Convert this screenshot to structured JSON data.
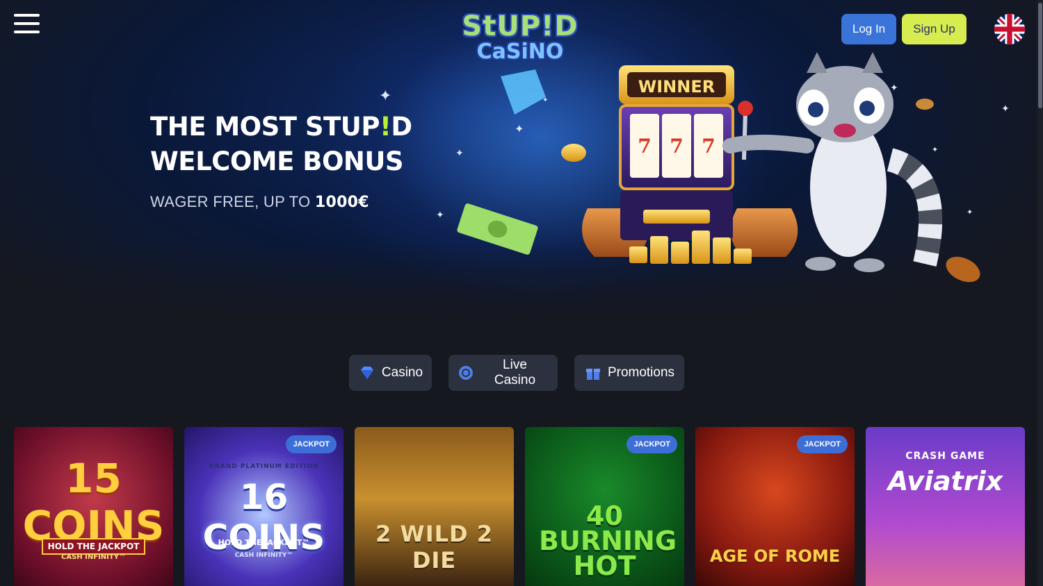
{
  "header": {
    "logo_line1": "StUP!D",
    "logo_line2": "CaSiNO",
    "login_label": "Log In",
    "signup_label": "Sign Up",
    "language_icon": "uk-flag-icon"
  },
  "hero": {
    "title_part1": "THE MOST STUP",
    "title_bang": "!",
    "title_part2": "D",
    "title_line2": "WELCOME BONUS",
    "subtitle_prefix": "WAGER FREE, UP TO ",
    "subtitle_amount": "1000€",
    "slot_banner": "WINNER"
  },
  "categories": [
    {
      "label": "Casino",
      "icon": "diamond-icon"
    },
    {
      "label": "Live Casino",
      "icon": "poker-chip-icon"
    },
    {
      "label": "Promotions",
      "icon": "gift-icon"
    }
  ],
  "games": [
    {
      "title": "15 COINS",
      "tagline": "HOLD THE JACKPOT",
      "sub": "CASH INFINITY™",
      "badge": ""
    },
    {
      "title": "16 COINS",
      "tagline": "HOLD THE JACKPOT™",
      "sub": "CASH INFINITY™",
      "top": "GRAND PLATINUM EDITION",
      "badge": "JACKPOT"
    },
    {
      "title": "2 WILD 2 DIE",
      "badge": ""
    },
    {
      "title": "40 BURNING HOT",
      "badge": "JACKPOT"
    },
    {
      "title": "AGE OF ROME",
      "badge": "JACKPOT"
    },
    {
      "title": "Aviatrix",
      "top": "CRASH GAME",
      "badge": ""
    }
  ],
  "colors": {
    "background": "#16181f",
    "login": "#3a74d8",
    "signup": "#d6ec4f",
    "accent": "#b9ef3a",
    "category_bg": "#2c3140"
  }
}
